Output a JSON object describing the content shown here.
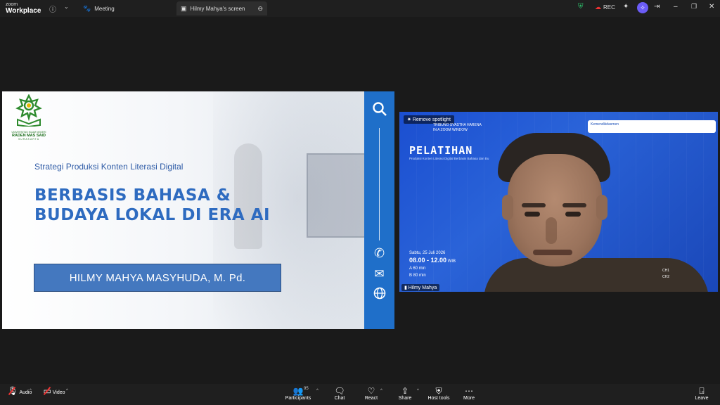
{
  "app": {
    "logo_top": "zoom",
    "logo_bottom": "Workplace"
  },
  "topbar": {
    "tabs": [
      {
        "label": "Meeting",
        "icon": "meeting-icon"
      },
      {
        "label": "Hilmy Mahya's screen",
        "icon": "screen-share-icon"
      }
    ],
    "rec_label": "REC"
  },
  "slide": {
    "university_small": "UNIVERSITAS ISLAM NEGERI",
    "university_name": "RADEN MAS SAID",
    "university_city": "SURAKARTA",
    "subtitle": "Strategi Produksi Konten Literasi Digital",
    "title": "BERBASIS BAHASA & BUDAYA LOKAL DI ERA AI",
    "presenter": "HILMY MAHYA MASYHUDA, M. Pd."
  },
  "video": {
    "remove_spotlight": "Remove spotlight",
    "tribuno_line1": "TRIBUNO SVASTHA HARENA",
    "tribuno_line2": "IN A ZOOM WINDOW",
    "pelatihan": "PELATIHAN",
    "pelatihan_sub": "Produksi Konten Literasi Digital Berbasis Bahasa dan Bu",
    "kemen_label": "Kemendikdasmen",
    "date": "Sabtu, 25 Juli 2026",
    "time": "08.00 - 12.00",
    "time_zone": "WIB",
    "session_a": "A  60 min",
    "session_b": "B  80 min",
    "ch1": "CH1",
    "ch2": "CH2",
    "participant_name": "Hilmy Mahya"
  },
  "bottombar": {
    "audio": "Audio",
    "video": "Video",
    "participants": "Participants",
    "participants_count": "95",
    "chat": "Chat",
    "react": "React",
    "share": "Share",
    "host_tools": "Host tools",
    "more": "More",
    "leave": "Leave"
  },
  "colors": {
    "accent_blue": "#1f6fc9",
    "title_blue": "#2e6bc0",
    "leave_red": "#e33"
  }
}
